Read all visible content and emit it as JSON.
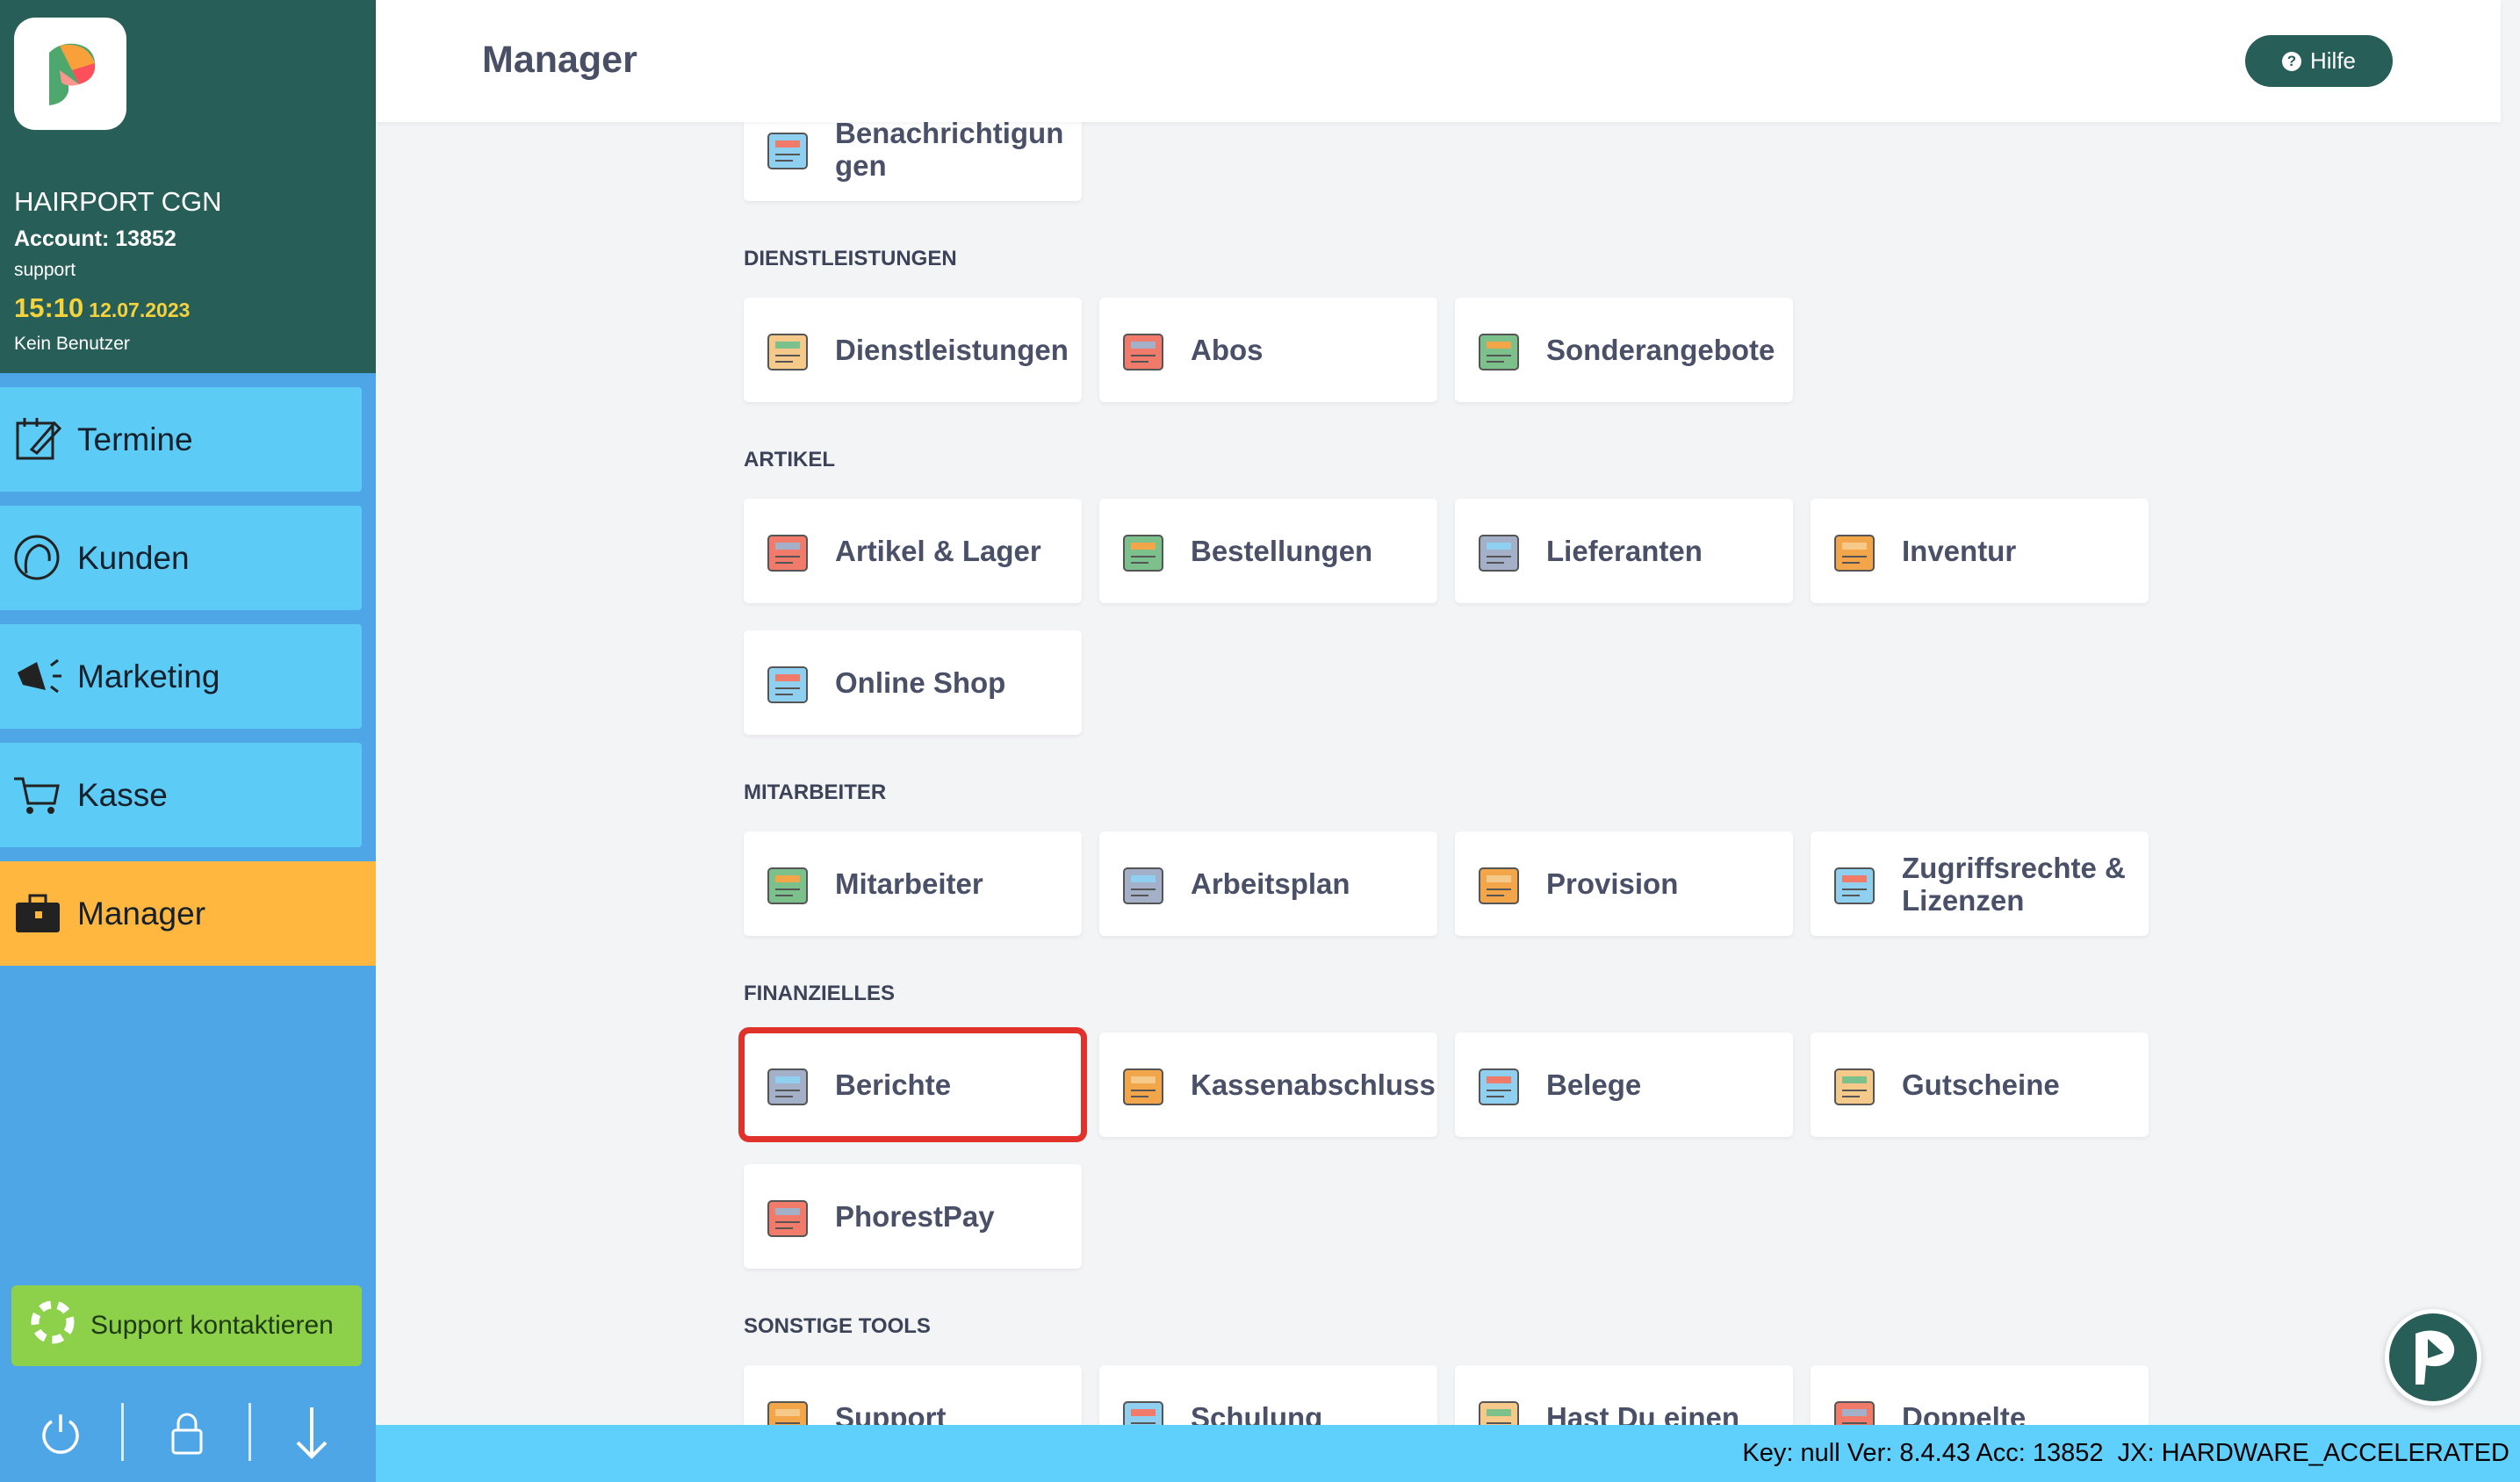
{
  "account": {
    "shop": "HAIRPORT CGN",
    "account": "Account: 13852",
    "user": "support",
    "time": "15:10",
    "date": "12.07.2023",
    "employee": "Kein Benutzer"
  },
  "sidebar": {
    "items": [
      {
        "label": "Termine",
        "icon": "calendar-edit-icon"
      },
      {
        "label": "Kunden",
        "icon": "customer-head-icon"
      },
      {
        "label": "Marketing",
        "icon": "megaphone-icon"
      },
      {
        "label": "Kasse",
        "icon": "cart-icon"
      },
      {
        "label": "Manager",
        "icon": "briefcase-icon",
        "active": true
      }
    ],
    "support_label": "Support kontaktieren"
  },
  "header": {
    "title": "Manager",
    "help_label": "Hilfe"
  },
  "sections": [
    {
      "label": "",
      "cards": [
        {
          "label": "Benachrichtigungen",
          "display": "Benachrichtigun gen",
          "icon": "bell-icon"
        }
      ]
    },
    {
      "label": "DIENSTLEISTUNGEN",
      "cards": [
        {
          "label": "Dienstleistungen",
          "icon": "compass-icon"
        },
        {
          "label": "Abos",
          "icon": "checklist-icon"
        },
        {
          "label": "Sonderangebote",
          "icon": "price-tag-icon"
        }
      ]
    },
    {
      "label": "ARTIKEL",
      "cards": [
        {
          "label": "Artikel & Lager",
          "icon": "products-icon"
        },
        {
          "label": "Bestellungen",
          "icon": "package-icon"
        },
        {
          "label": "Lieferanten",
          "icon": "truck-icon"
        },
        {
          "label": "Inventur",
          "icon": "barcode-search-icon"
        },
        {
          "label": "Online Shop",
          "icon": "shopping-bag-icon"
        }
      ]
    },
    {
      "label": "MITARBEITER",
      "cards": [
        {
          "label": "Mitarbeiter",
          "icon": "team-icon"
        },
        {
          "label": "Arbeitsplan",
          "icon": "calendar-grid-icon"
        },
        {
          "label": "Provision",
          "icon": "coin-hands-icon"
        },
        {
          "label": "Zugriffsrechte & Lizenzen",
          "icon": "padlock-dial-icon"
        }
      ]
    },
    {
      "label": "FINANZIELLES",
      "cards": [
        {
          "label": "Berichte",
          "icon": "chart-icon",
          "selected": true
        },
        {
          "label": "Kassenabschluss",
          "icon": "cash-register-icon"
        },
        {
          "label": "Belege",
          "icon": "receipt-icon"
        },
        {
          "label": "Gutscheine",
          "icon": "gift-voucher-icon"
        },
        {
          "label": "PhorestPay",
          "icon": "card-terminal-icon"
        }
      ]
    },
    {
      "label": "SONSTIGE TOOLS",
      "cards": [
        {
          "label": "Support",
          "icon": "phone-icon"
        },
        {
          "label": "Schulung",
          "icon": "graduation-cap-icon"
        },
        {
          "label": "Hast Du einen",
          "icon": "microphone-icon"
        },
        {
          "label": "Doppelte",
          "icon": "duplicate-clients-icon"
        }
      ]
    }
  ],
  "status": "Key: null Ver: 8.4.43 Acc: 13852  JX: HARDWARE_ACCELERATED",
  "colors": {
    "sidebar_top": "#285e58",
    "sidebar": "#4ea6e7",
    "nav": "#5ccbf6",
    "active": "#ffb73f",
    "support": "#8dd04a",
    "highlight": "#e0322a",
    "status_bar": "#5fcffb"
  }
}
